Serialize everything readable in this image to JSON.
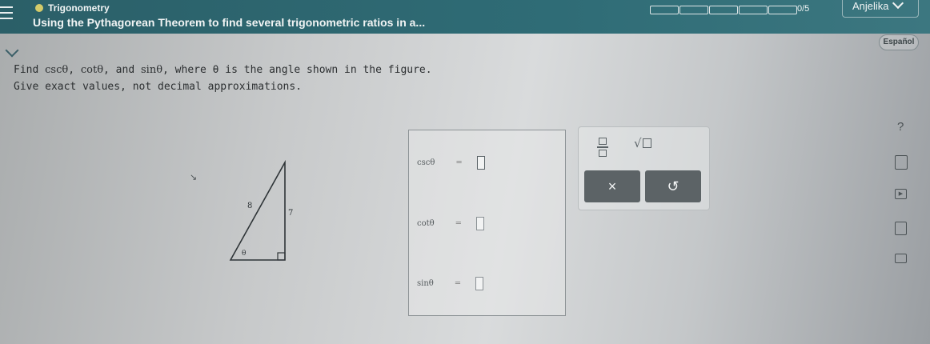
{
  "header": {
    "course": "Trigonometry",
    "lesson_title": "Using the Pythagorean Theorem to find several trigonometric ratios in a...",
    "progress_text": "0/5",
    "progress_segments": 5,
    "progress_filled": 0,
    "user_name": "Anjelika"
  },
  "language_button": "Español",
  "question": {
    "line1_prefix": "Find ",
    "csc": "cscθ",
    "sep1": ", ",
    "cot": "cotθ",
    "sep2": ", and ",
    "sin": "sinθ",
    "line1_suffix": ", where θ is the angle shown in the figure.",
    "line2": "Give exact values, not decimal approximations."
  },
  "figure": {
    "hypotenuse": "8",
    "opposite": "7",
    "angle": "θ"
  },
  "answers": [
    {
      "label": "cscθ",
      "equals": "=",
      "value": ""
    },
    {
      "label": "cotθ",
      "equals": "=",
      "value": ""
    },
    {
      "label": "sinθ",
      "equals": "=",
      "value": ""
    }
  ],
  "keypad": {
    "clear": "×",
    "undo": "↺"
  },
  "rail": {
    "help": "?"
  },
  "colors": {
    "header": "#2f6c76",
    "button": "#5c6366"
  }
}
